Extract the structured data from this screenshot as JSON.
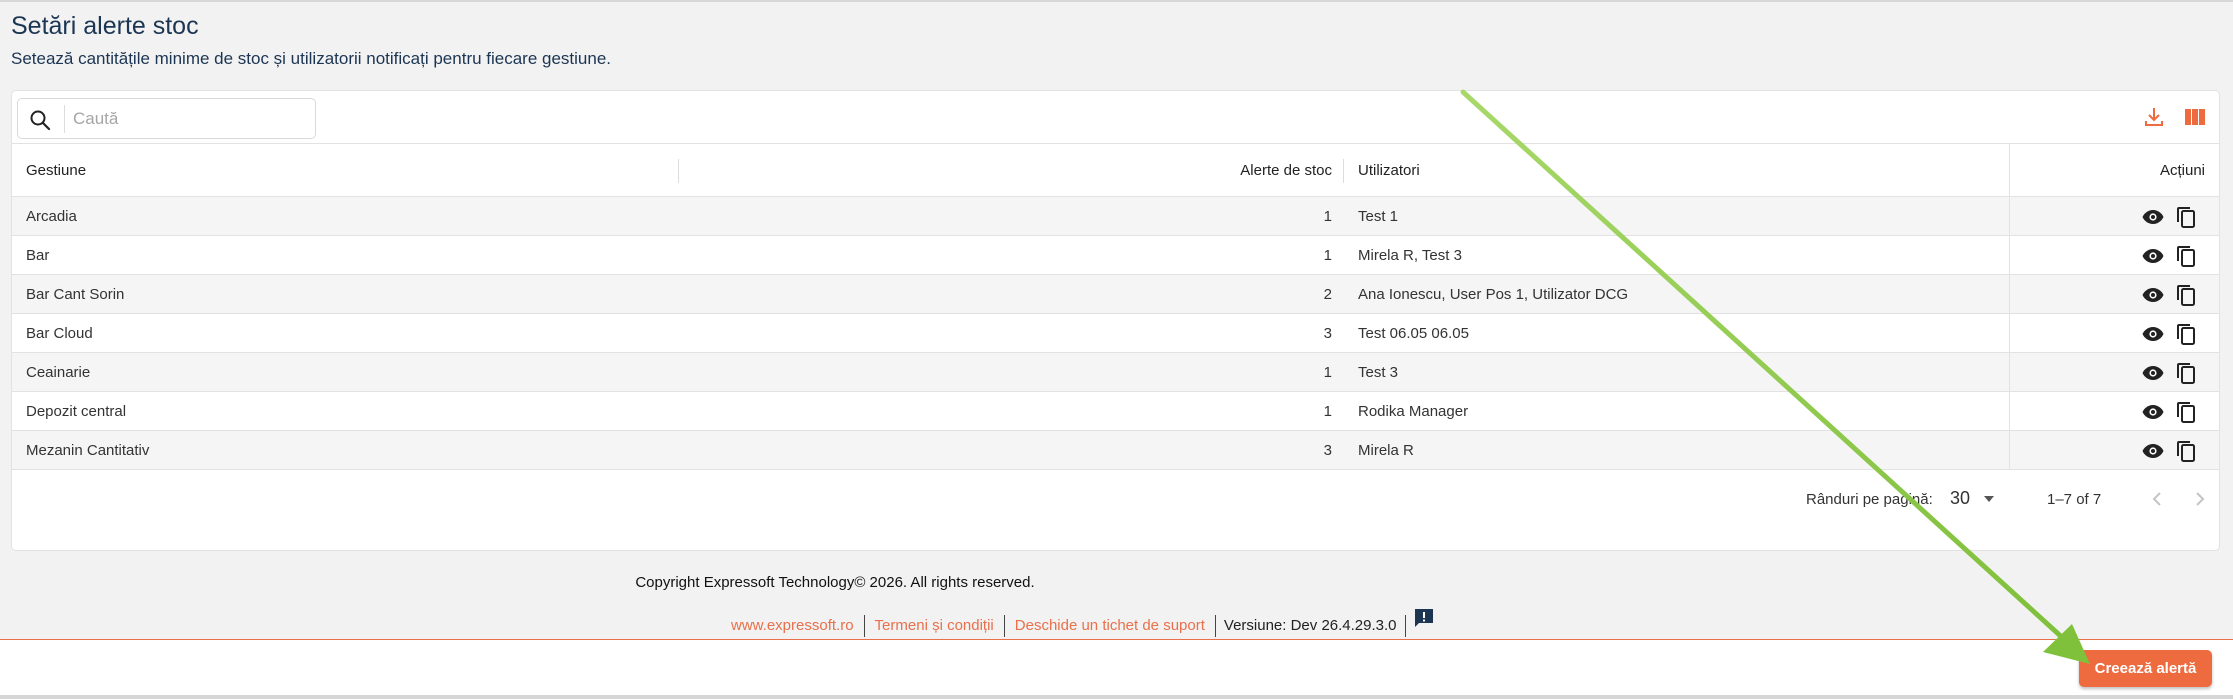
{
  "page": {
    "title": "Setări alerte stoc",
    "subtitle": "Setează cantitățile minime de stoc și utilizatorii notificați pentru fiecare gestiune."
  },
  "search": {
    "placeholder": "Caută",
    "value": ""
  },
  "table": {
    "columns": {
      "gestiune": "Gestiune",
      "alerte": "Alerte de stoc",
      "utilizatori": "Utilizatori",
      "actiuni": "Acțiuni"
    },
    "rows": [
      {
        "gestiune": "Arcadia",
        "alerte": "1",
        "utilizatori": "Test 1"
      },
      {
        "gestiune": "Bar",
        "alerte": "1",
        "utilizatori": "Mirela R, Test 3"
      },
      {
        "gestiune": "Bar Cant Sorin",
        "alerte": "2",
        "utilizatori": "Ana Ionescu, User Pos 1, Utilizator DCG"
      },
      {
        "gestiune": "Bar Cloud",
        "alerte": "3",
        "utilizatori": "Test 06.05 06.05"
      },
      {
        "gestiune": "Ceainarie",
        "alerte": "1",
        "utilizatori": "Test 3"
      },
      {
        "gestiune": "Depozit central",
        "alerte": "1",
        "utilizatori": "Rodika Manager"
      },
      {
        "gestiune": "Mezanin Cantitativ",
        "alerte": "3",
        "utilizatori": "Mirela R"
      }
    ]
  },
  "pagination": {
    "rows_per_page_label": "Rânduri pe pagină:",
    "rows_per_page": "30",
    "range": "1–7 of 7"
  },
  "footer": {
    "copyright": "Copyright Expressoft Technology© 2026. All rights reserved.",
    "link_site": "www.expressoft.ro",
    "link_terms": "Termeni și condiții",
    "link_ticket": "Deschide un tichet de suport",
    "version": "Versiune: Dev 26.4.29.3.0"
  },
  "actions": {
    "create_label": "Creează alertă"
  },
  "colors": {
    "accent": "#ee6a3f",
    "link": "#e8704b",
    "title": "#1c3553",
    "annotation_arrow": "#8cc63f"
  },
  "icons": [
    "search-icon",
    "download-icon",
    "columns-icon",
    "eye-icon",
    "copy-icon",
    "chevron-left-icon",
    "chevron-right-icon",
    "feedback-icon"
  ]
}
